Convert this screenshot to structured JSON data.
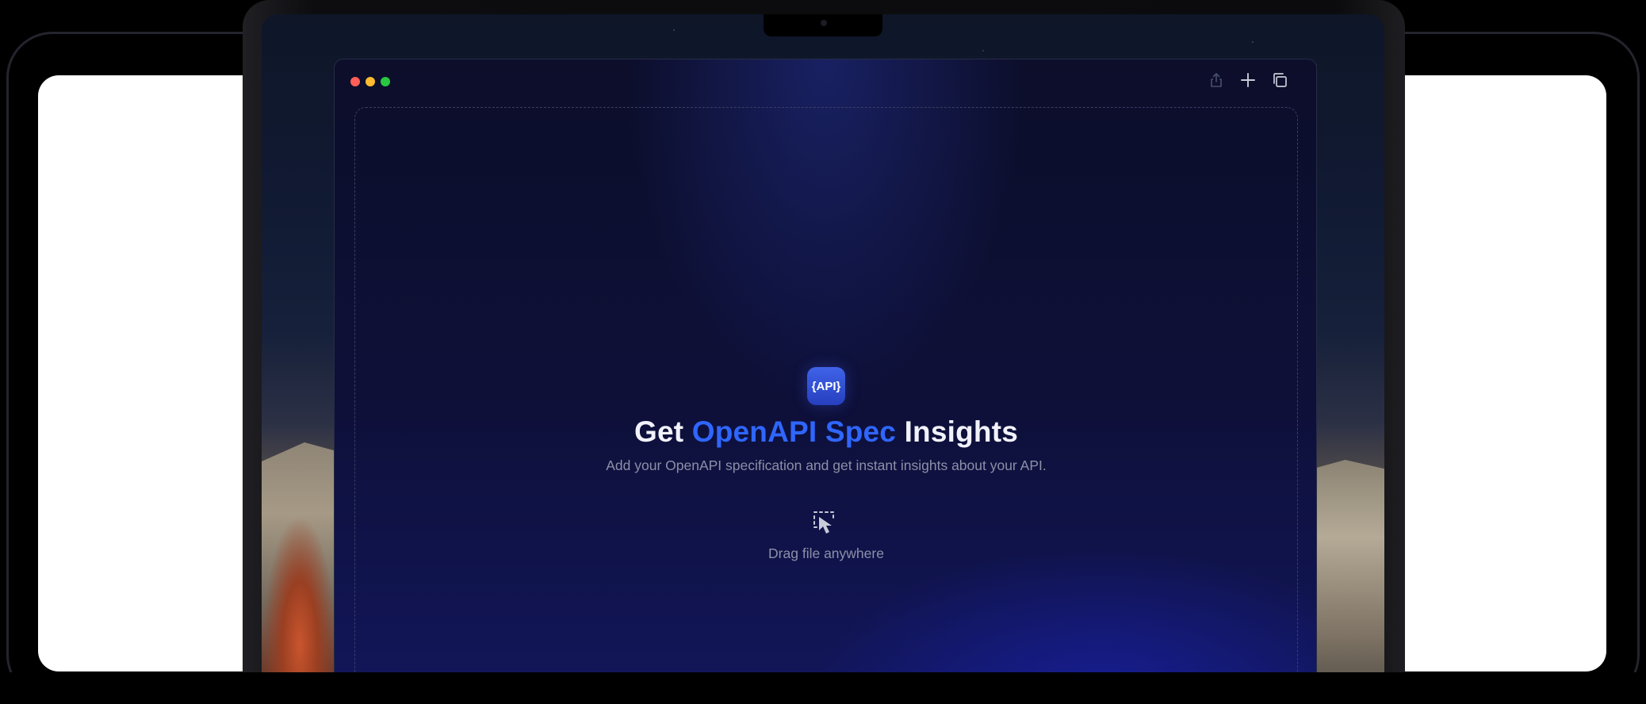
{
  "app": {
    "logo_text": "{API}",
    "headline": {
      "prefix": "Get ",
      "accent": "OpenAPI Spec",
      "suffix": " Insights"
    },
    "subtitle": "Add your OpenAPI specification and get instant insights about your API.",
    "dropzone": {
      "label": "Drag file anywhere",
      "icon": "drag-select-icon"
    }
  },
  "window_controls": {
    "traffic_lights": [
      {
        "name": "close",
        "color": "#ff5f57"
      },
      {
        "name": "minimize",
        "color": "#febc2e"
      },
      {
        "name": "zoom",
        "color": "#28c840"
      }
    ],
    "actions": [
      {
        "name": "share",
        "icon": "share-icon",
        "enabled": false
      },
      {
        "name": "new-tab",
        "icon": "plus-icon",
        "enabled": true
      },
      {
        "name": "tab-overview",
        "icon": "tabs-icon",
        "enabled": true
      }
    ]
  },
  "colors": {
    "accent": "#2f66ff",
    "background": "#0e1039",
    "text_primary": "#f1f2fa",
    "text_secondary": "#8d90a6"
  }
}
